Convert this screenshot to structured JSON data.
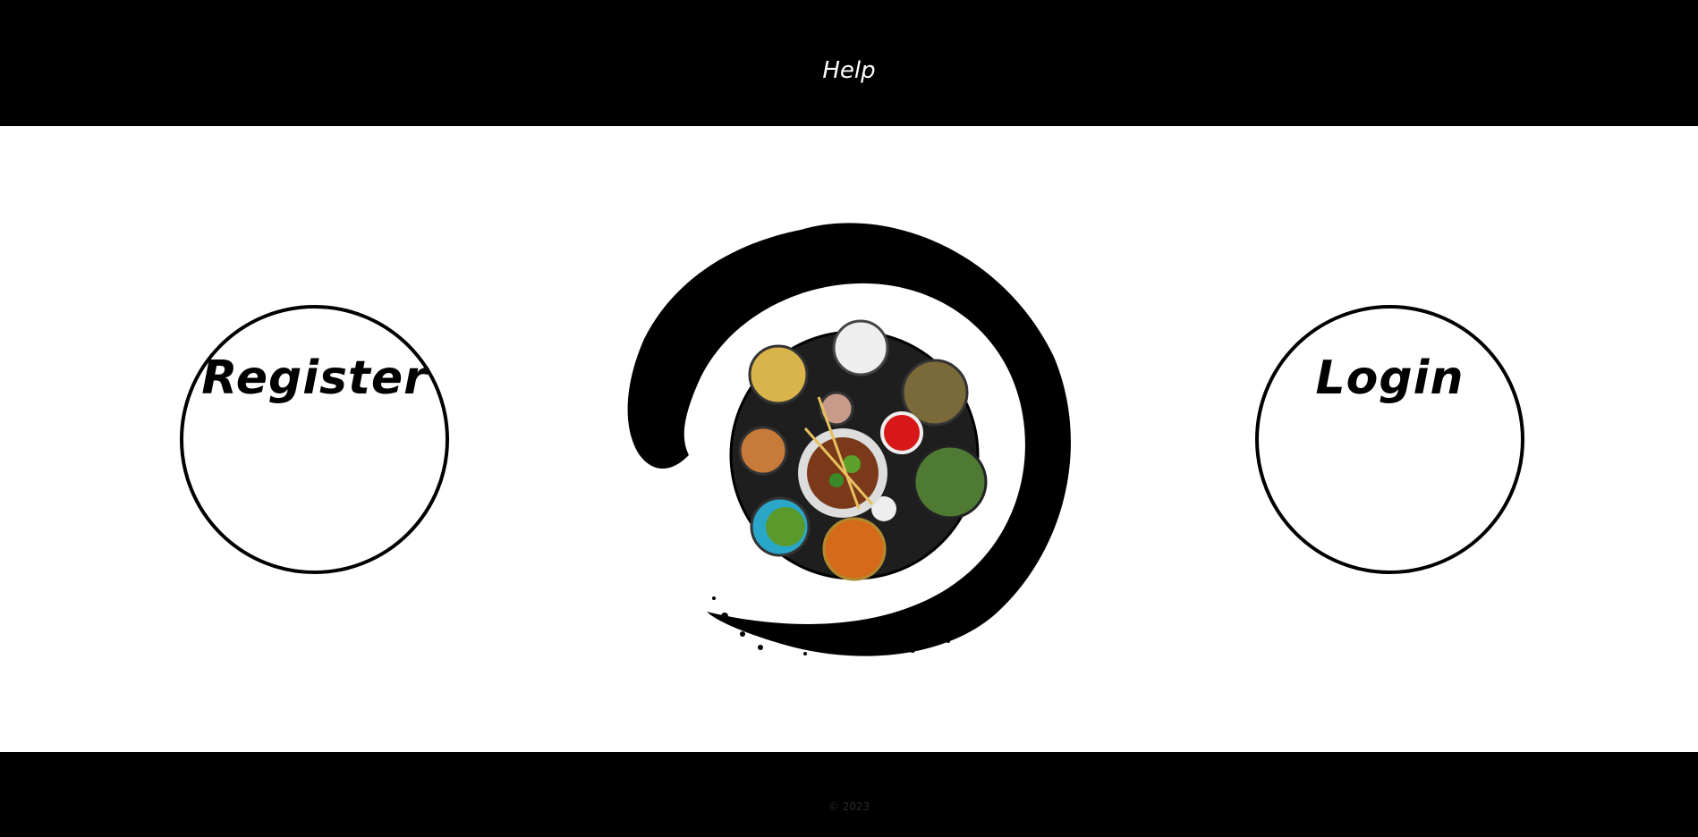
{
  "header": {
    "help_label": "Help"
  },
  "main": {
    "register_label": "Register",
    "login_label": "Login",
    "logo_alt": "food-bowl-ink-circle"
  },
  "footer": {
    "copyright": "© 2023"
  },
  "colors": {
    "bar": "#000000",
    "background": "#ffffff",
    "ink": "#000000"
  }
}
